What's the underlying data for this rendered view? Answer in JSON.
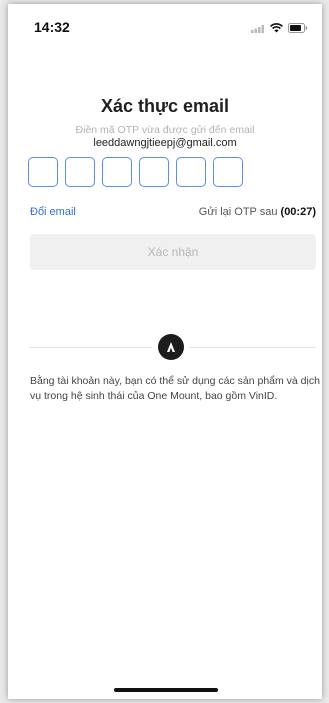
{
  "status_bar": {
    "time": "14:32"
  },
  "verify": {
    "title": "Xác thực email",
    "subtitle": "Điền mã OTP vừa được gửi đến email",
    "email": "leeddawngjtieepj@gmail.com",
    "otp_digits": [
      "",
      "",
      "",
      "",
      "",
      ""
    ],
    "change_email_label": "Đổi email",
    "resend_label": "Gửi lại OTP sau",
    "resend_timer": "(00:27)",
    "confirm_label": "Xác nhận"
  },
  "footer": {
    "disclaimer": "Bằng tài khoản này, bạn có thể sử dụng các sản phẩm và dịch vụ trong hệ sinh thái của One Mount, bao gồm VinID."
  },
  "colors": {
    "accent": "#2f6fdd",
    "otp_border": "#5b8def",
    "button_bg": "#f0f0f0",
    "logo_bg": "#1d1d1d"
  },
  "icons": [
    "signal-icon",
    "wifi-icon",
    "battery-icon",
    "one-mount-logo-icon"
  ]
}
